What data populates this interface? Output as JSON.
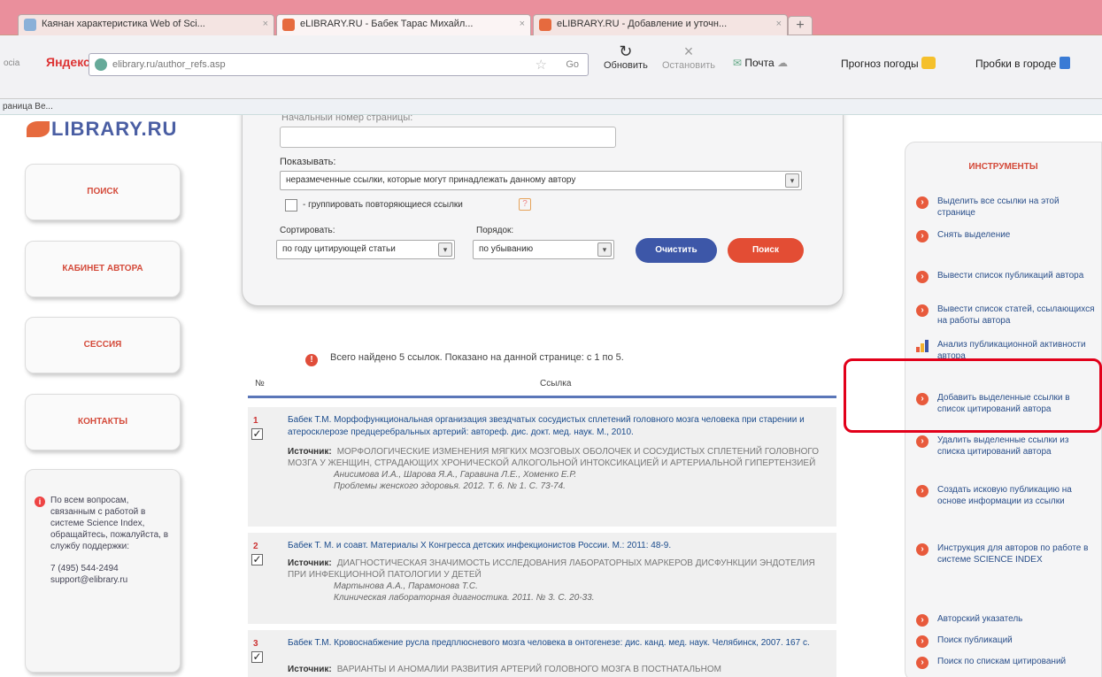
{
  "browser": {
    "tabs": [
      {
        "label": "Каянан характеристика Web of Sci...",
        "active": false
      },
      {
        "label": "eLIBRARY.RU - Бабек Тарас Михайл...",
        "active": true
      },
      {
        "label": "eLIBRARY.RU - Добавление и уточн...",
        "active": false
      }
    ],
    "new_tab": "+",
    "nav_stub": "ocia",
    "yandex": "Яндекс",
    "address": "elibrary.ru/author_refs.asp",
    "go_label": "Go",
    "refresh_label": "Обновить",
    "stop_label": "Остановить",
    "mail_label": "Почта",
    "weather_label": "Прогноз погоды",
    "traffic_label": "Пробки в городе",
    "bookmark": "раница Ве..."
  },
  "logo": "LIBRARY.RU",
  "sidebar": {
    "items": [
      "ПОИСК",
      "КАБИНЕТ АВТОРА",
      "СЕССИЯ",
      "КОНТАКТЫ"
    ],
    "help_text": "По всем вопросам, связанным с работой в системе Science Index, обращайтесь, пожалуйста, в службу поддержки:",
    "phone": "7 (495) 544-2494",
    "email": "support@elibrary.ru"
  },
  "filter": {
    "field_label": "Начальный номер страницы:",
    "show_label": "Показывать:",
    "show_value": "неразмеченные ссылки, которые могут принадлежать данному автору",
    "group_label": "- группировать повторяющиеся ссылки",
    "help_glyph": "?",
    "sort_label": "Сортировать:",
    "sort_value": "по году цитирующей статьи",
    "order_label": "Порядок:",
    "order_value": "по убыванию",
    "clear_button": "Очистить",
    "search_button": "Поиск"
  },
  "info": "Всего найдено 5 ссылок. Показано на данной странице: с 1 по 5.",
  "table": {
    "col_num": "№",
    "col_ref": "Ссылка",
    "source_label": "Источник:",
    "rows": [
      {
        "num": "1",
        "checked": true,
        "ref": "Бабек Т.М. Морфофункциональная организация звездчатых сосудистых сплетений головного мозга человека при старении и атеросклерозе предцеребральных артерий: автореф. дис. докт. мед. наук. М., 2010.",
        "source_title": "МОРФОЛОГИЧЕСКИЕ ИЗМЕНЕНИЯ МЯГКИХ МОЗГОВЫХ ОБОЛОЧЕК И СОСУДИСТЫХ СПЛЕТЕНИЙ ГОЛОВНОГО МОЗГА У ЖЕНЩИН, СТРАДАЮЩИХ ХРОНИЧЕСКОЙ АЛКОГОЛЬНОЙ ИНТОКСИКАЦИЕЙ И АРТЕРИАЛЬНОЙ ГИПЕРТЕНЗИЕЙ",
        "authors": "Анисимова И.А., Шарова Я.А., Гаравина Л.Е., Хоменко Е.Р.",
        "journal": "Проблемы женского здоровья. 2012. Т. 6. № 1. С. 73-74."
      },
      {
        "num": "2",
        "checked": true,
        "ref": "Бабек Т. М. и соавт. Материалы X Конгресса детских инфекционистов России. М.: 2011: 48-9.",
        "source_title": "ДИАГНОСТИЧЕСКАЯ ЗНАЧИМОСТЬ ИССЛЕДОВАНИЯ ЛАБОРАТОРНЫХ МАРКЕРОВ ДИСФУНКЦИИ ЭНДОТЕЛИЯ ПРИ ИНФЕКЦИОННОЙ ПАТОЛОГИИ У ДЕТЕЙ",
        "authors": "Мартынова А.А., Парамонова Т.С.",
        "journal": "Клиническая лабораторная диагностика. 2011. № 3. С. 20-33."
      },
      {
        "num": "3",
        "checked": true,
        "ref": "Бабек Т.М. Кровоснабжение русла предплюсневого мозга человека в онтогенезе: дис. канд. мед. наук. Челябинск, 2007. 167 с.",
        "source_title": "ВАРИАНТЫ И АНОМАЛИИ РАЗВИТИЯ АРТЕРИЙ ГОЛОВНОГО МОЗГА В ПОСТНАТАЛЬНОМ",
        "authors": "",
        "journal": ""
      }
    ]
  },
  "tools": {
    "title": "ИНСТРУМЕНТЫ",
    "items": [
      {
        "label": "Выделить все ссылки на этой странице",
        "icon": "circle-icon"
      },
      {
        "label": "Снять выделение",
        "icon": "circle-icon"
      },
      {
        "label": "Вывести список публикаций автора",
        "icon": "circle-icon"
      },
      {
        "label": "Вывести список статей, ссылающихся на работы автора",
        "icon": "circle-icon"
      },
      {
        "label": "Анализ публикационной активности автора",
        "icon": "bar-chart-icon"
      },
      {
        "label": "Добавить выделенные ссылки в список цитирований автора",
        "icon": "circle-icon"
      },
      {
        "label": "Удалить выделенные ссылки из списка цитирований автора",
        "icon": "circle-icon"
      },
      {
        "label": "Создать исковую публикацию на основе информации из ссылки",
        "icon": "circle-icon"
      },
      {
        "label": "Инструкция для авторов по работе в системе SCIENCE INDEX",
        "icon": "circle-icon"
      },
      {
        "label": "Авторский указатель",
        "icon": "circle-icon"
      },
      {
        "label": "Поиск публикаций",
        "icon": "circle-icon"
      },
      {
        "label": "Поиск по спискам цитирований",
        "icon": "circle-icon"
      }
    ]
  },
  "colors": {
    "accent_red": "#e04d3a",
    "link_blue": "#2a4f8a",
    "highlight": "#e2001a",
    "button_blue": "#3d57a8",
    "button_red": "#e34d34"
  }
}
